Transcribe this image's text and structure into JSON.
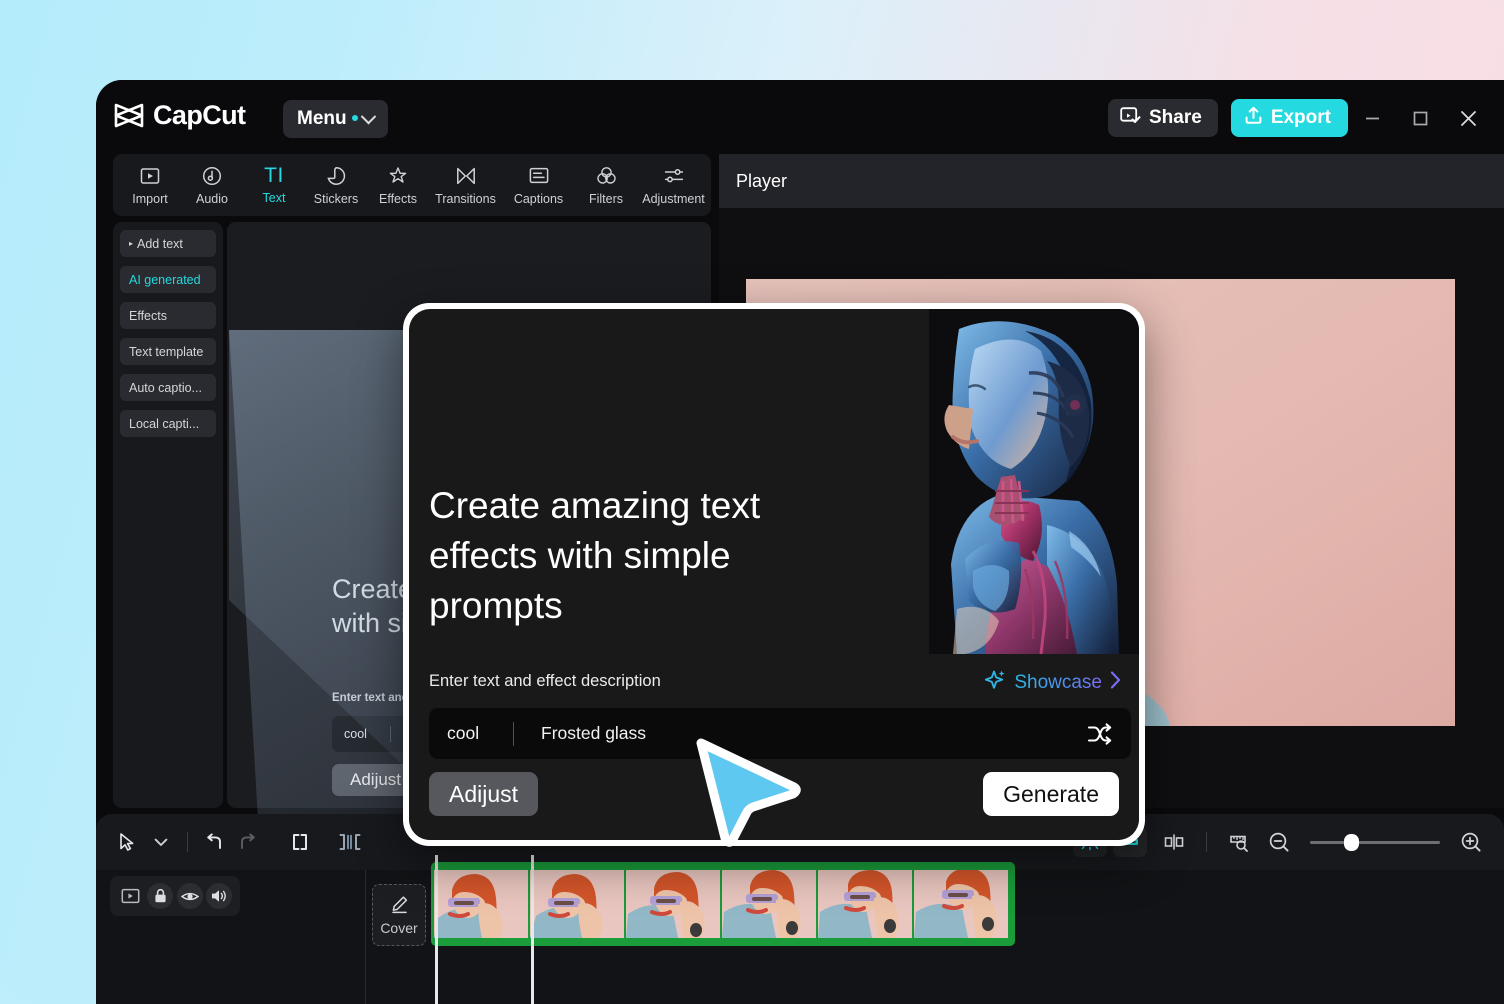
{
  "background": {
    "left_color": "#b4ecfb",
    "right_color": "#fbdee3"
  },
  "titlebar": {
    "brand": "CapCut",
    "menu_label": "Menu",
    "share_label": "Share",
    "export_label": "Export",
    "accent_color": "#25d9e0",
    "window_minimize": "minimize-icon",
    "window_maximize": "maximize-icon",
    "window_close": "close-icon"
  },
  "tools": [
    {
      "label": "Import",
      "icon": "import-icon",
      "active": false
    },
    {
      "label": "Audio",
      "icon": "audio-icon",
      "active": false
    },
    {
      "label": "Text",
      "icon": "TI",
      "active": true
    },
    {
      "label": "Stickers",
      "icon": "stickers-icon",
      "active": false
    },
    {
      "label": "Effects",
      "icon": "effects-icon",
      "active": false
    },
    {
      "label": "Transitions",
      "icon": "transitions-icon",
      "active": false
    },
    {
      "label": "Captions",
      "icon": "captions-icon",
      "active": false
    },
    {
      "label": "Filters",
      "icon": "filters-icon",
      "active": false
    },
    {
      "label": "Adjustment",
      "icon": "adjustment-icon",
      "active": false
    }
  ],
  "tools_more": "»",
  "sidebar": {
    "items": [
      {
        "label": "Add text",
        "active": false,
        "has_caret": true
      },
      {
        "label": "AI generated",
        "active": true,
        "has_caret": false
      },
      {
        "label": "Effects",
        "active": false,
        "has_caret": false
      },
      {
        "label": "Text template",
        "active": false,
        "has_caret": false
      },
      {
        "label": "Auto captio...",
        "active": false,
        "has_caret": false
      },
      {
        "label": "Local capti...",
        "active": false,
        "has_caret": false
      }
    ]
  },
  "ai_panel": {
    "headline": "Create amazing text effects with simple prompts",
    "label": "Enter text and effect description",
    "prompt_text": "cool",
    "prompt_effect": "Frosted glass",
    "adjust_label": "Adijust"
  },
  "player": {
    "title": "Player"
  },
  "timeline": {
    "toolbar_left": [
      {
        "icon": "select-arrow-icon"
      },
      {
        "icon": "chevron-down-icon"
      },
      {
        "icon": "undo-icon"
      },
      {
        "icon": "redo-icon"
      },
      {
        "icon": "split-icon"
      },
      {
        "icon": "crop-split-icon"
      }
    ],
    "toolbar_right": [
      {
        "icon": "keyframe-icon",
        "active": true
      },
      {
        "icon": "mirror-icon",
        "active": true
      },
      {
        "icon": "delete-split-icon",
        "active": false
      },
      {
        "icon": "measure-icon",
        "active": false
      },
      {
        "icon": "zoom-out-icon",
        "active": false
      },
      {
        "icon": "zoom-in-icon",
        "active": false
      }
    ],
    "track_controls": [
      {
        "icon": "main-track-icon"
      },
      {
        "icon": "lock-icon"
      },
      {
        "icon": "eye-icon"
      },
      {
        "icon": "volume-icon"
      }
    ],
    "cover_label": "Cover",
    "cover_icon": "pencil-icon",
    "clip_border_color": "#1a9c3a",
    "thumbnail_count": 6,
    "zoom_value": 26
  },
  "modal": {
    "headline": "Create amazing text effects with simple prompts",
    "label": "Enter text and effect description",
    "showcase_label": "Showcase",
    "showcase_icon": "sparkle-icon",
    "showcase_chevron": "chevron-right-icon",
    "prompt_text": "cool",
    "prompt_effect": "Frosted glass",
    "shuffle_icon": "shuffle-icon",
    "adjust_label": "Adijust",
    "generate_label": "Generate",
    "hero_image": "ai-robot-woman-image"
  },
  "cursor": {
    "icon": "pointer-cursor",
    "color": "#5ec8f0"
  }
}
